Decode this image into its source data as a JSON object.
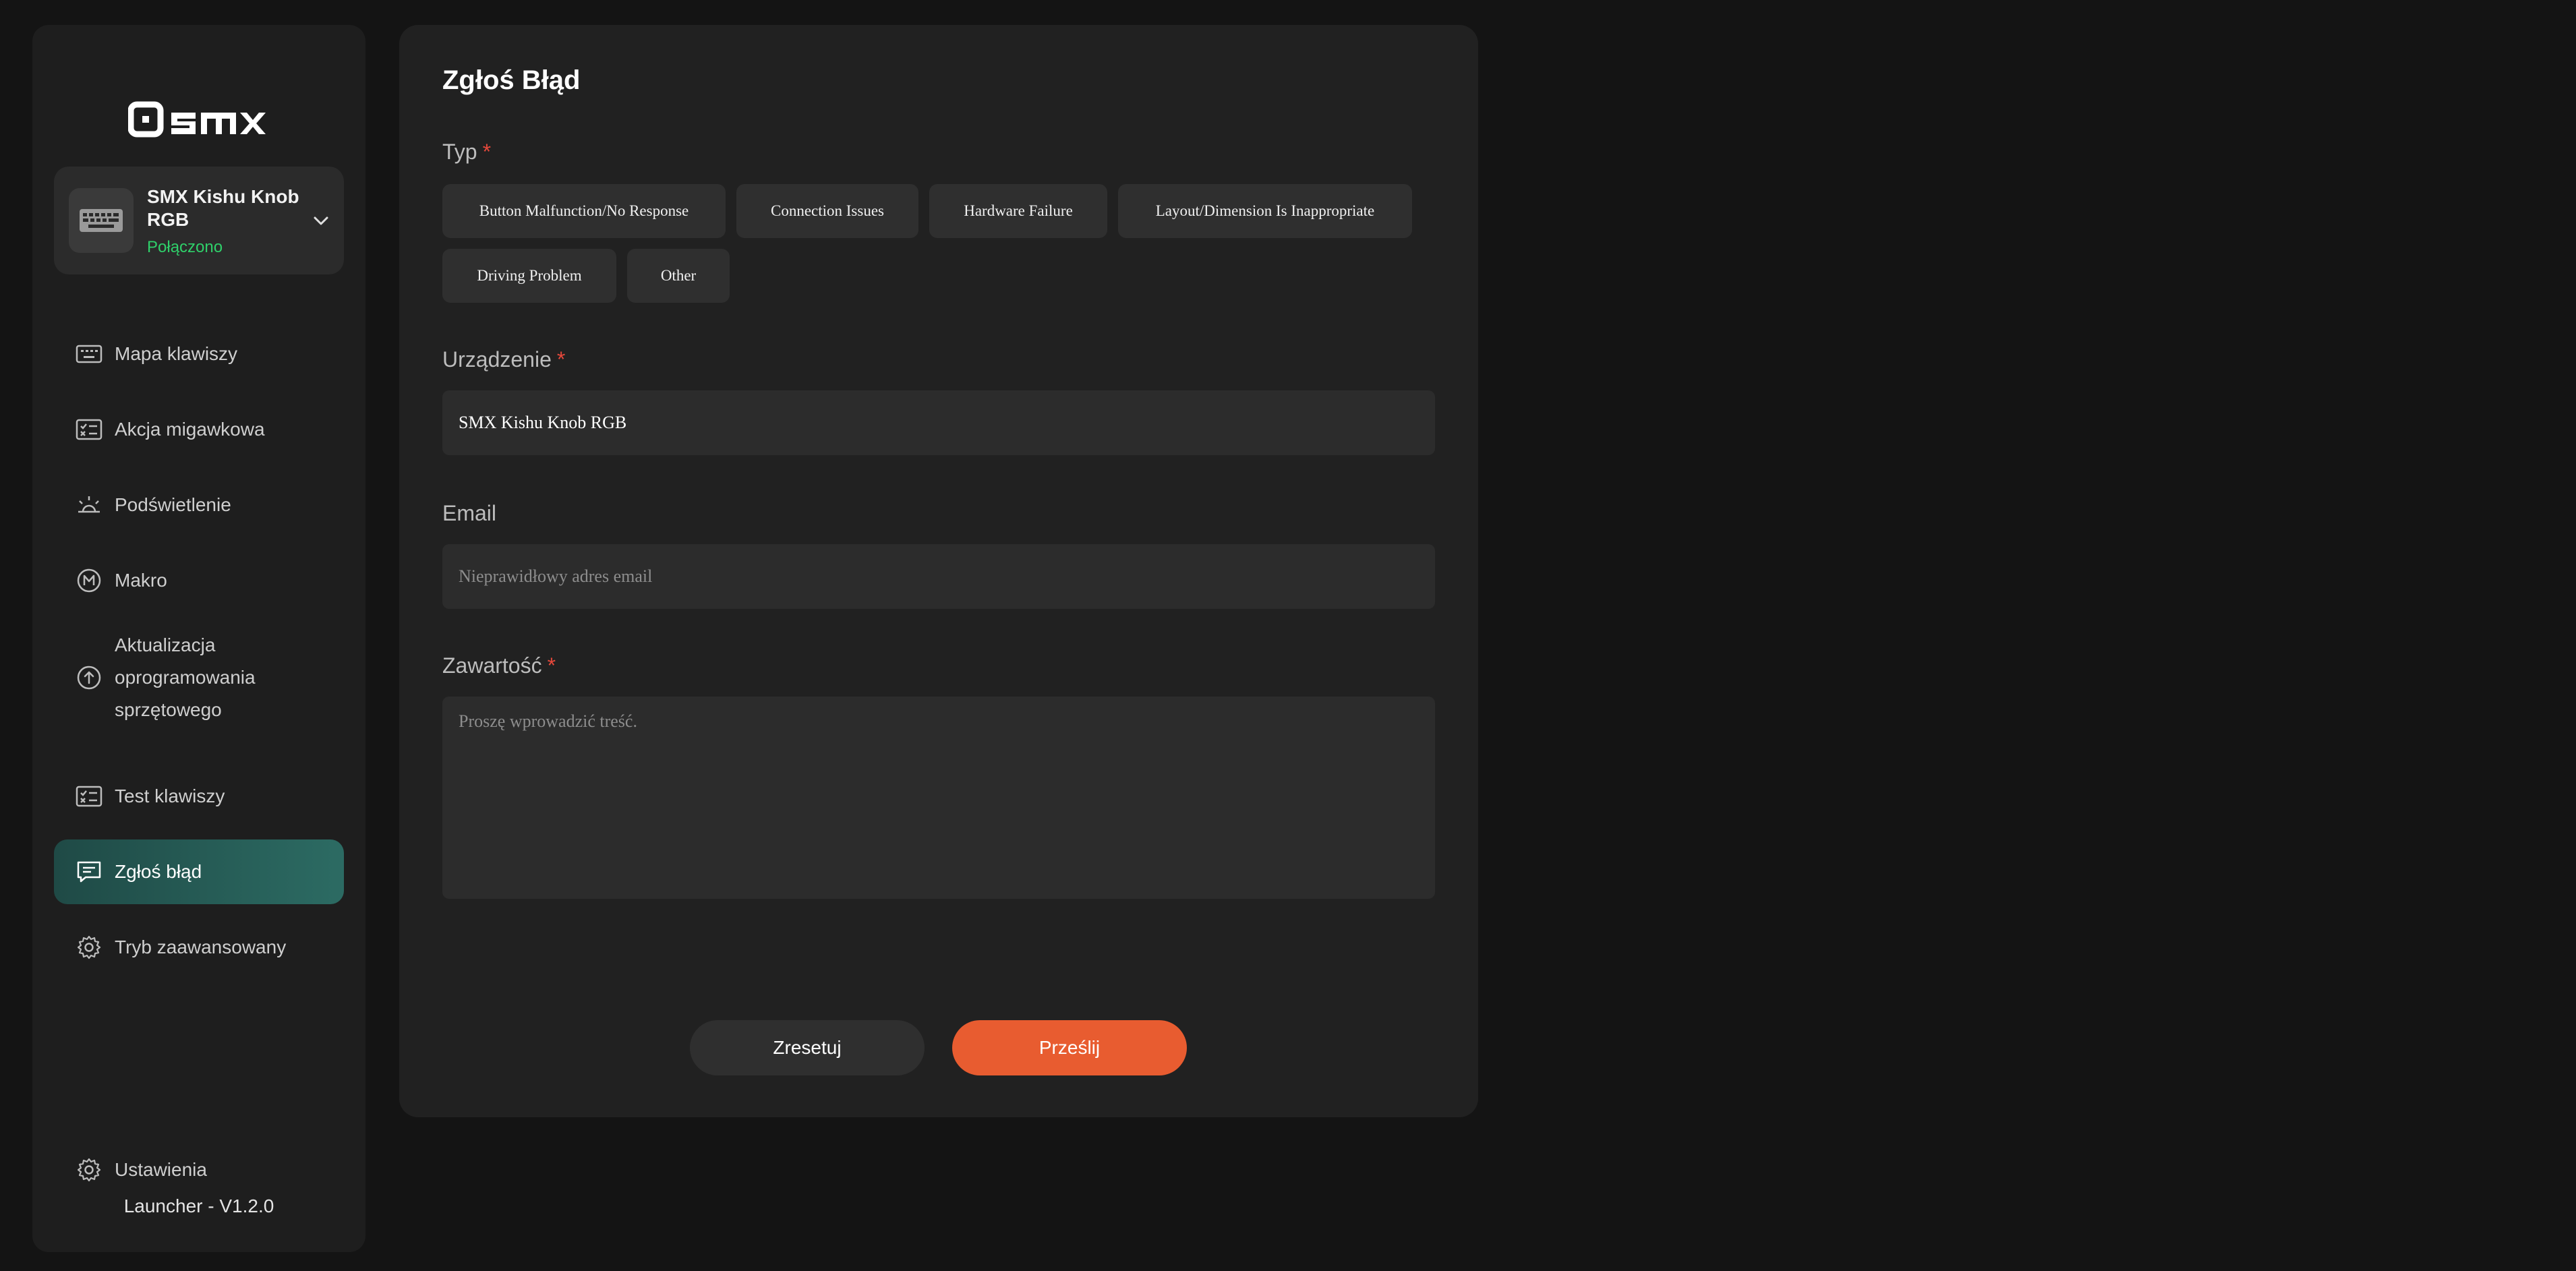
{
  "app": {
    "logo_text": "SMX",
    "version": "Launcher - V1.2.0"
  },
  "device": {
    "name": "SMX Kishu Knob RGB",
    "status": "Połączono",
    "status_color": "#2fd06a",
    "icon": "keyboard-icon"
  },
  "sidebar": {
    "items": [
      {
        "label": "Mapa klawiszy",
        "icon": "keyboard-icon"
      },
      {
        "label": "Akcja migawkowa",
        "icon": "checklist-icon"
      },
      {
        "label": "Podświetlenie",
        "icon": "light-icon"
      },
      {
        "label": "Makro",
        "icon": "macro-m-icon"
      },
      {
        "label": "Aktualizacja oprogramowania sprzętowego",
        "icon": "upload-arrow-icon"
      },
      {
        "label": "Test klawiszy",
        "icon": "checklist-icon"
      },
      {
        "label": "Zgłoś błąd",
        "icon": "message-icon",
        "active": true
      },
      {
        "label": "Tryb zaawansowany",
        "icon": "gear-icon"
      },
      {
        "label": "Ustawienia",
        "icon": "gear-icon"
      }
    ]
  },
  "form": {
    "title": "Zgłoś Błąd",
    "type_label": "Typ",
    "types": [
      "Button Malfunction/No Response",
      "Connection Issues",
      "Hardware Failure",
      "Layout/Dimension Is Inappropriate",
      "Driving Problem",
      "Other"
    ],
    "device_label": "Urządzenie",
    "device_value": "SMX Kishu Knob RGB",
    "email_label": "Email",
    "email_placeholder": "Nieprawidłowy adres email",
    "content_label": "Zawartość",
    "content_placeholder": "Proszę wprowadzić treść.",
    "required_mark": "*",
    "reset_label": "Zresetuj",
    "submit_label": "Prześlij"
  },
  "colors": {
    "accent": "#e85c30",
    "active_nav": "#2c6b63",
    "required": "#e5483b"
  }
}
